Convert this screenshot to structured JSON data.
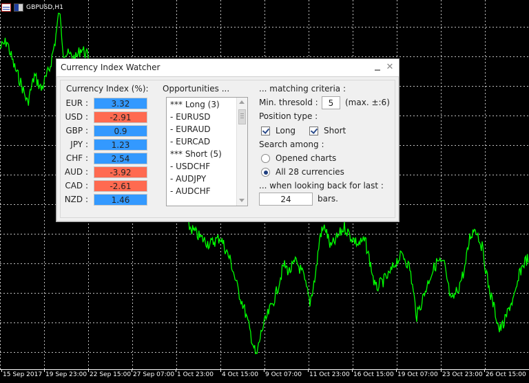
{
  "chart": {
    "symbol": "GBPUSD,H1",
    "line_color": "#00ff00",
    "grid_color": "#c0c0c0",
    "background": "#000000",
    "time_labels": [
      "15 Sep 2017",
      "19 Sep 23:00",
      "22 Sep 15:00",
      "27 Sep 07:00",
      "1 Oct 23:00",
      "4 Oct 15:00",
      "9 Oct 07:00",
      "11 Oct 23:00",
      "16 Oct 15:00",
      "19 Oct 07:00",
      "23 Oct 23:00",
      "26 Oct 15:00"
    ]
  },
  "panel": {
    "title": "Currency Index Watcher",
    "currency_header": "Currency Index (%):",
    "currencies": [
      {
        "label": "EUR :",
        "value": "3.32",
        "color": "#3399ff"
      },
      {
        "label": "USD :",
        "value": "-2.91",
        "color": "#ff6a50"
      },
      {
        "label": "GBP :",
        "value": "0.9",
        "color": "#3399ff"
      },
      {
        "label": "JPY :",
        "value": "1.23",
        "color": "#3399ff"
      },
      {
        "label": "CHF :",
        "value": "2.54",
        "color": "#3399ff"
      },
      {
        "label": "AUD :",
        "value": "-3.92",
        "color": "#ff6a50"
      },
      {
        "label": "CAD :",
        "value": "-2.61",
        "color": "#ff6a50"
      },
      {
        "label": "NZD :",
        "value": "1.46",
        "color": "#3399ff"
      }
    ],
    "opportunities_header": "Opportunities ...",
    "opportunities": [
      "*** Long (3)",
      " - EURUSD",
      " - EURAUD",
      " - EURCAD",
      "*** Short (5)",
      " - USDCHF",
      " - AUDJPY",
      " - AUDCHF"
    ],
    "criteria_header": "... matching criteria :",
    "min_threshold_label": "Min. thresold :",
    "min_threshold_value": "5",
    "max_hint": "(max. ±:6)",
    "position_type_label": "Position type :",
    "long_label": "Long",
    "short_label": "Short",
    "search_among_label": "Search among :",
    "opened_charts_label": "Opened charts",
    "all_currencies_label": "All 28 currencies",
    "lookback_label": "... when looking back for last :",
    "lookback_value": "24",
    "bars_label": "bars."
  }
}
